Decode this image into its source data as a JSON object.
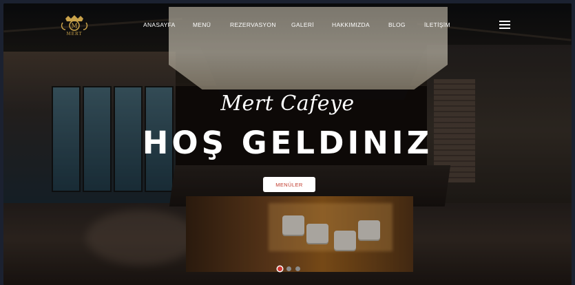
{
  "brand": {
    "logo_text": "MERT",
    "logo_monogram": "M",
    "accent_color": "#d23a35"
  },
  "nav": {
    "items": [
      {
        "label": "ANASAYFA"
      },
      {
        "label": "MENÜ"
      },
      {
        "label": "REZERVASYON"
      },
      {
        "label": "GALERİ"
      },
      {
        "label": "HAKKIMIZDA"
      },
      {
        "label": "BLOG"
      },
      {
        "label": "İLETİŞİM"
      }
    ],
    "menu_icon": "hamburger-icon"
  },
  "hero": {
    "subtitle": "Mert Cafeye",
    "title": "HOŞ GELDINIZ",
    "cta_label": "MENÜLER"
  },
  "slider": {
    "count": 3,
    "active_index": 0
  }
}
